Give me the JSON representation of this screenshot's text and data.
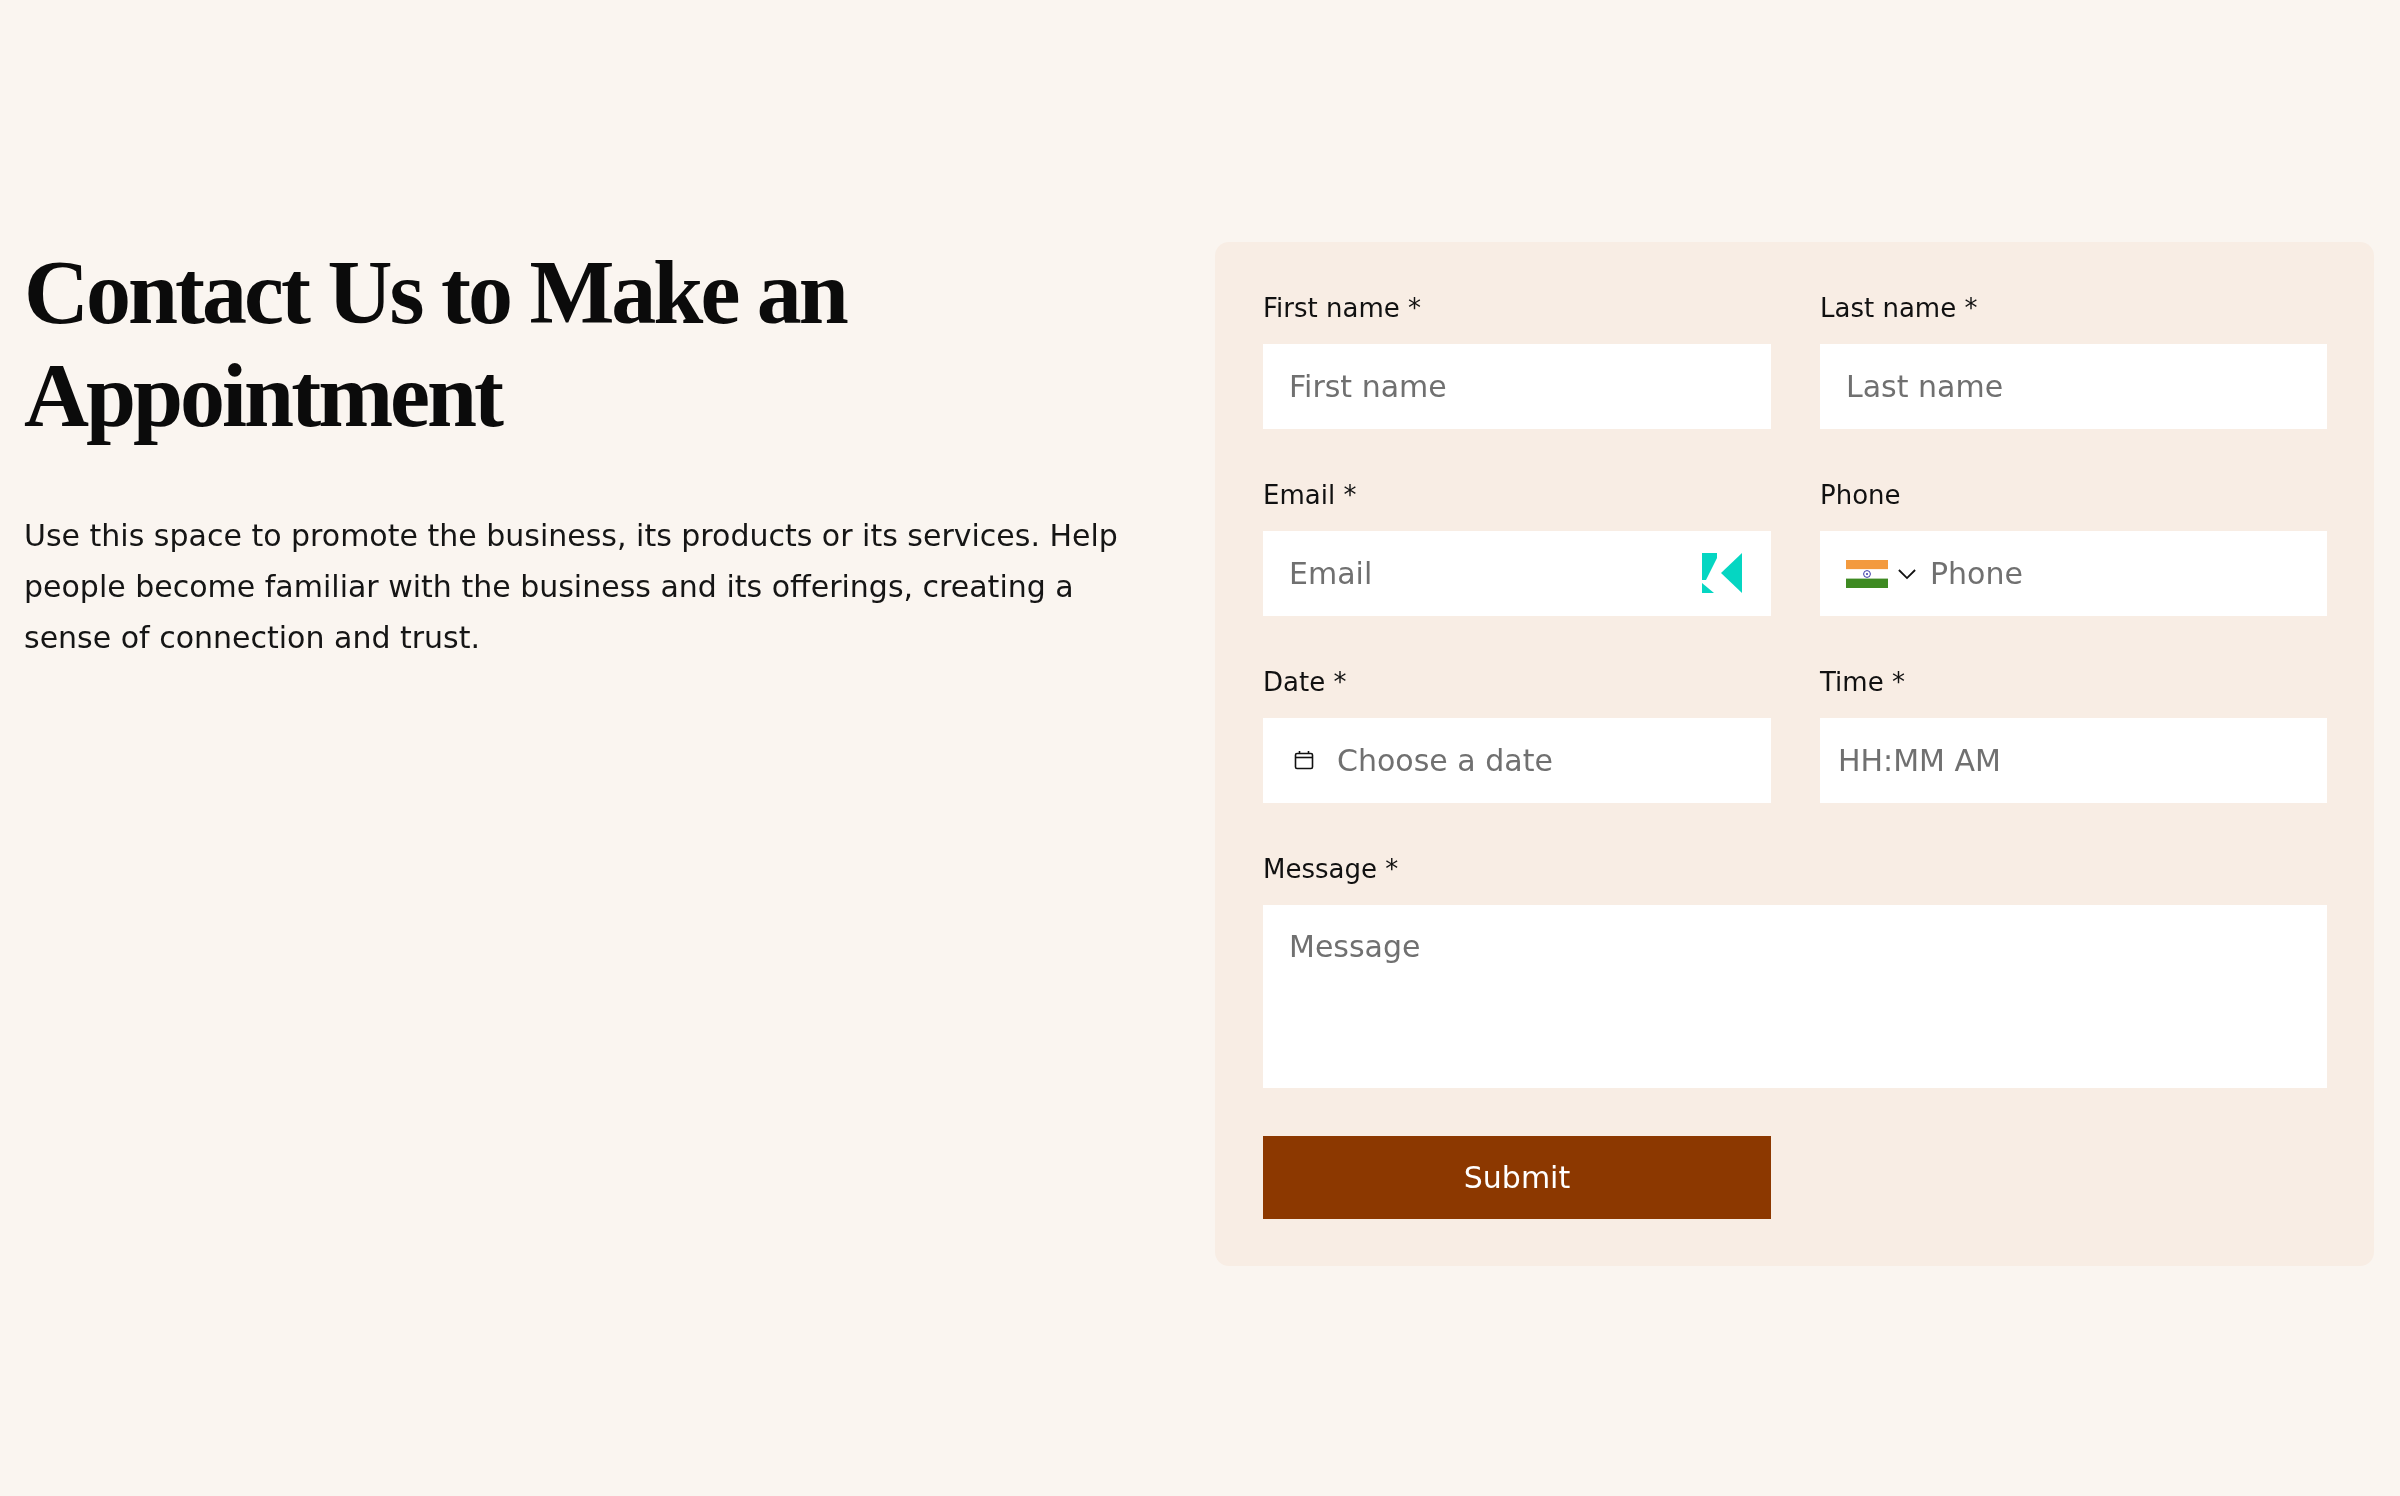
{
  "heading": "Contact Us to Make an Appointment",
  "intro": "Use this space to promote the business, its products or its services. Help people become familiar with the business and its offerings, creating a sense of connection and trust.",
  "form": {
    "fields": [
      {
        "kind": "text",
        "label": "First name *",
        "placeholder": "First name"
      },
      {
        "kind": "text",
        "label": "Last name *",
        "placeholder": "Last name"
      },
      {
        "kind": "email",
        "label": "Email *",
        "placeholder": "Email"
      },
      {
        "kind": "phone",
        "label": "Phone",
        "placeholder": "Phone"
      },
      {
        "kind": "date",
        "label": "Date *",
        "placeholder": "Choose a date"
      },
      {
        "kind": "time",
        "label": "Time *",
        "placeholder": "HH:MM AM"
      },
      {
        "kind": "message",
        "label": "Message *",
        "placeholder": "Message"
      }
    ],
    "submit": "Submit"
  }
}
